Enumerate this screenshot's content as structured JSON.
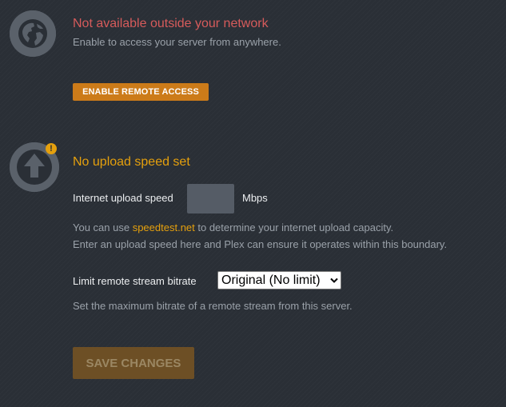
{
  "remote_access": {
    "status_title": "Not available outside your network",
    "description": "Enable to access your server from anywhere.",
    "enable_button": "ENABLE REMOTE ACCESS"
  },
  "upload": {
    "warning_badge": "!",
    "title": "No upload speed set",
    "speed_label": "Internet upload speed",
    "speed_value": "",
    "unit_label": "Mbps",
    "hint_prefix": "You can use ",
    "hint_link": "speedtest.net",
    "hint_suffix": " to determine your internet upload capacity.",
    "hint_line2": "Enter an upload speed here and Plex can ensure it operates within this boundary."
  },
  "bitrate": {
    "label": "Limit remote stream bitrate",
    "selected": "Original (No limit)",
    "description": "Set the maximum bitrate of a remote stream from this server."
  },
  "save_button": "SAVE CHANGES",
  "icons": {
    "globe": "globe-icon",
    "upload": "upload-arrow-icon",
    "warning": "warning-icon",
    "chevron": "chevron-down-icon"
  },
  "colors": {
    "background": "#2a2f36",
    "error": "#d65b5b",
    "warning": "#e5a00d",
    "accent_button": "#cc7b19",
    "disabled_button": "#6d4f25"
  }
}
